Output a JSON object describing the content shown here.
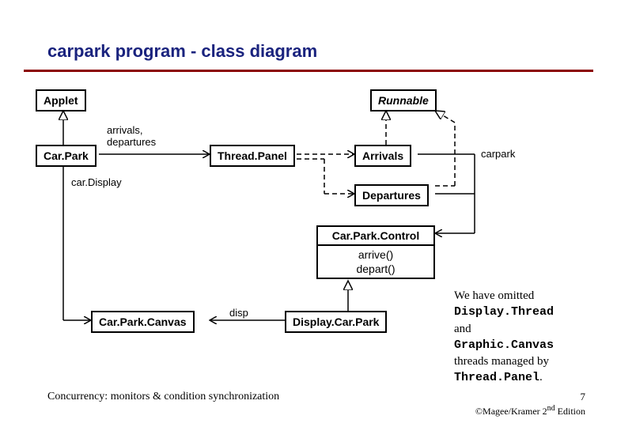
{
  "title": "carpark program - class diagram",
  "classes": {
    "applet": "Applet",
    "runnable": "Runnable",
    "carpark": "Car.Park",
    "threadpanel": "Thread.Panel",
    "arrivals": "Arrivals",
    "departures": "Departures",
    "carparkcontrol": {
      "name": "Car.Park.Control",
      "ops": [
        "arrive()",
        "depart()"
      ]
    },
    "carparkcanvas": "Car.Park.Canvas",
    "displaycarpark": "Display.Car.Park"
  },
  "labels": {
    "arrivals_departures": "arrivals,\ndepartures",
    "cardisplay": "car.Display",
    "disp": "disp",
    "carpark_assoc": "carpark"
  },
  "note": {
    "line1": "We have omitted",
    "code1": "Display.Thread",
    "mid": "and",
    "code2": "Graphic.Canvas",
    "line2": "threads managed by",
    "code3": "Thread.Panel",
    "dot": "."
  },
  "footer_left": "Concurrency: monitors & condition synchronization",
  "footer_right_pre": "©Magee/Kramer ",
  "footer_right_ed": "2",
  "footer_right_sup": "nd",
  "footer_right_post": " Edition",
  "page": "7"
}
